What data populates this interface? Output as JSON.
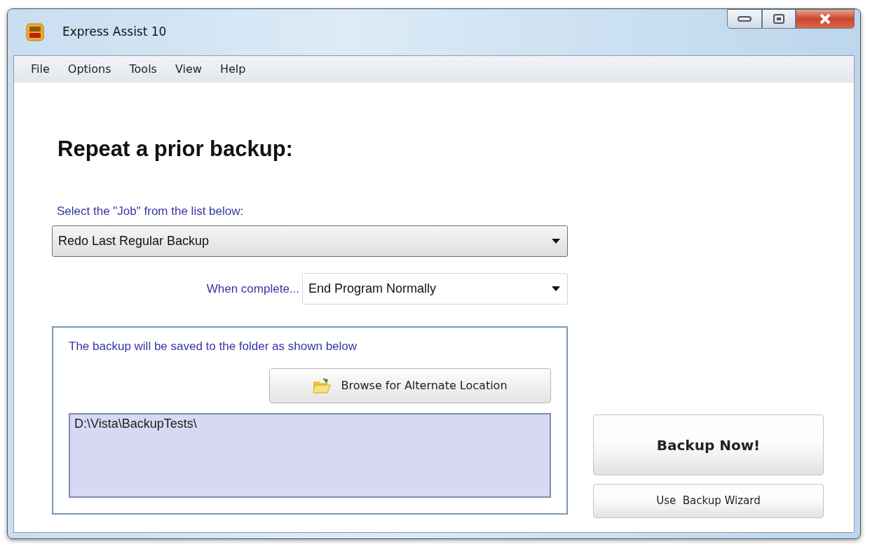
{
  "window": {
    "title": "Express Assist 10"
  },
  "menu": [
    "File",
    "Options",
    "Tools",
    "View",
    "Help"
  ],
  "heading": "Repeat a prior backup:",
  "job": {
    "label": "Select the \"Job\" from the list below:",
    "value": "Redo Last Regular Backup"
  },
  "when_complete": {
    "label": "When complete...",
    "value": "End Program Normally"
  },
  "destination": {
    "caption": "The backup will be saved to the folder as shown below",
    "browse_button": "Browse for Alternate Location",
    "path": "D:\\Vista\\BackupTests\\"
  },
  "buttons": [
    {
      "label": "Backup Now!",
      "kind": "primary"
    },
    {
      "label": "Use  Backup Wizard",
      "kind": "secondary"
    }
  ]
}
